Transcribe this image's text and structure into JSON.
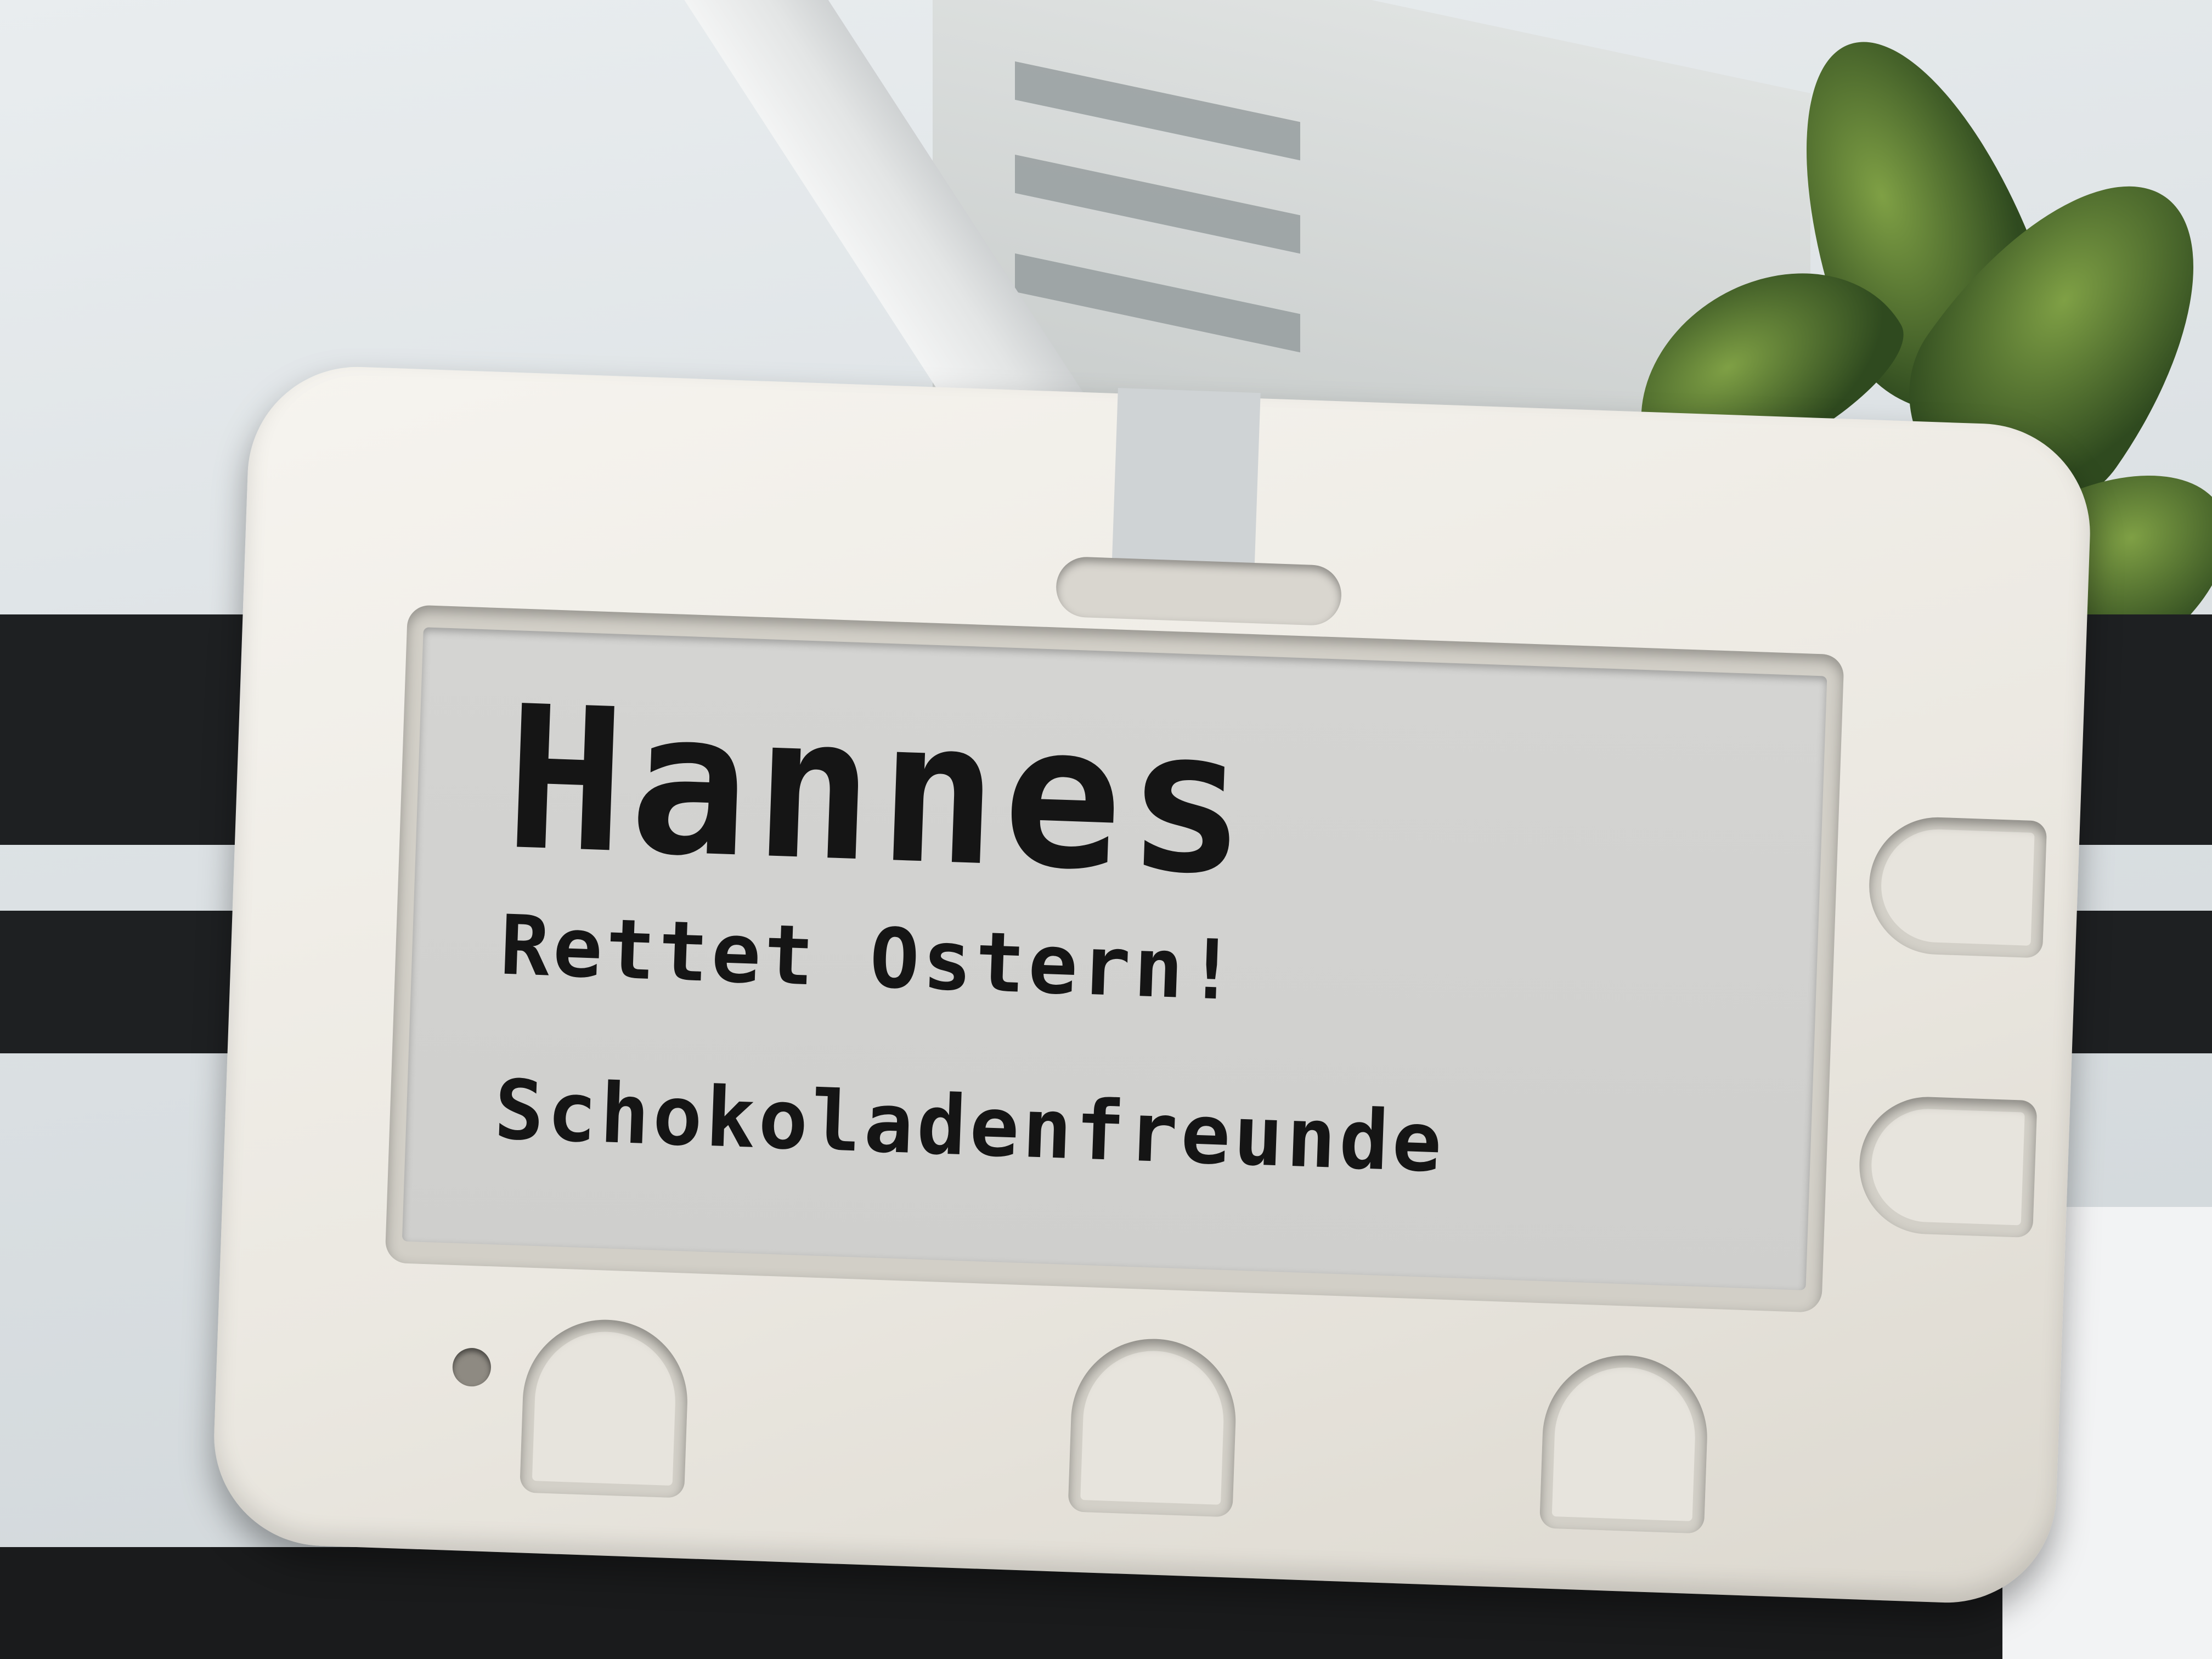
{
  "badge": {
    "name": "Hannes",
    "line1": "Rettet Ostern!",
    "line2": "Schokoladenfreunde"
  }
}
